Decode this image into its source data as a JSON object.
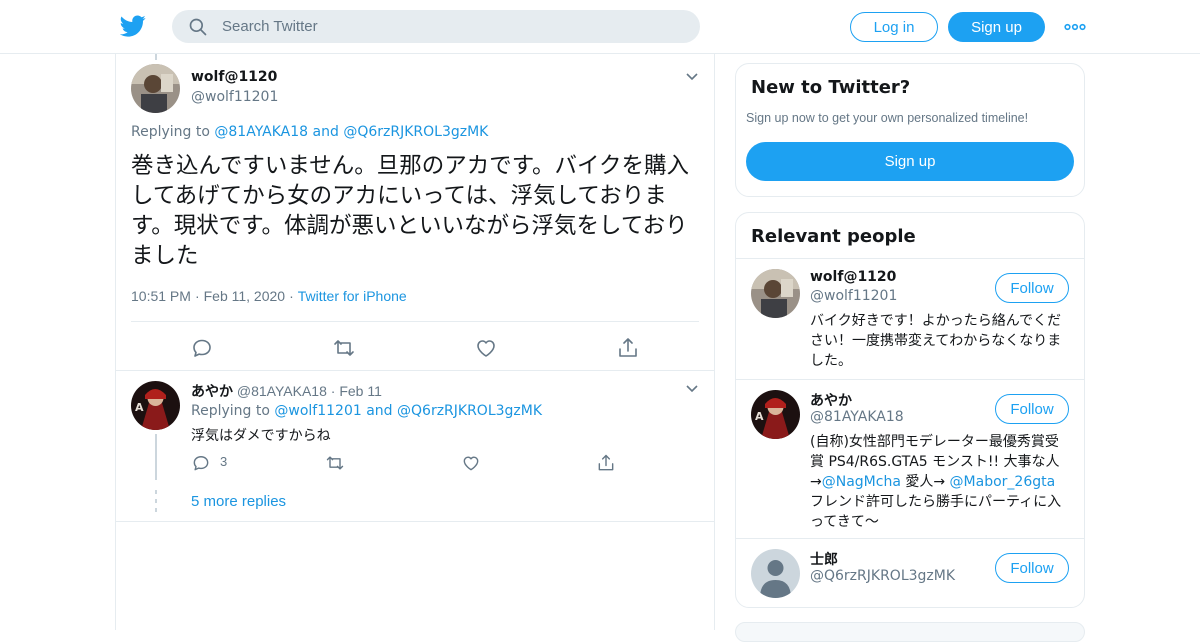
{
  "header": {
    "search_placeholder": "Search Twitter",
    "login_label": "Log in",
    "signup_label": "Sign up",
    "logo_icon": "twitter-bird-icon",
    "more_icon": "more-dots-icon",
    "brand_color": "#1da1f2"
  },
  "focused_tweet": {
    "name": "wolf@1120",
    "handle": "@wolf11201",
    "replying_prefix": "Replying to",
    "replying_to_1": "@81AYAKA18",
    "replying_and": "and",
    "replying_to_2": "@Q6rzRJKROL3gzMK",
    "text": "巻き込んですいません。旦那のアカです。バイクを購入してあげてから女のアカにいっては、浮気しております。現状です。体調が悪いといいながら浮気をしておりました",
    "time": "10:51 PM",
    "sep": "·",
    "date": "Feb 11, 2020",
    "source": "Twitter for iPhone",
    "actions": [
      "reply-icon",
      "retweet-icon",
      "like-icon",
      "share-icon"
    ]
  },
  "reply_tweet": {
    "name": "あやか",
    "handle": "@81AYAKA18",
    "sep": "·",
    "date": "Feb 11",
    "replying_prefix": "Replying to",
    "replying_to_1": "@wolf11201",
    "replying_and": "and",
    "replying_to_2": "@Q6rzRJKROL3gzMK",
    "text": "浮気はダメですからね",
    "reply_count": "3",
    "more_replies": "5 more replies"
  },
  "sidebar": {
    "new_to_twitter": {
      "title": "New to Twitter?",
      "subtitle": "Sign up now to get your own personalized timeline!",
      "button": "Sign up"
    },
    "relevant_people": {
      "title": "Relevant people",
      "follow_label": "Follow",
      "people": [
        {
          "name": "wolf@1120",
          "handle": "@wolf11201",
          "bio": "バイク好きです！よかったら絡んでください！一度携帯変えてわからなくなりました。"
        },
        {
          "name": "あやか",
          "handle": "@81AYAKA18",
          "bio_part1": "(自称)女性部門モデレーター最優秀賞受賞 PS4/R6S.GTA5 モンスト!! 大事な人→",
          "bio_mention1": "@NagMcha",
          "bio_part2": " 愛人→ ",
          "bio_mention2": "@Mabor_26gta",
          "bio_part3": " フレンド許可したら勝手にパーティに入ってきて〜"
        },
        {
          "name": "士郎",
          "handle": "@Q6rzRJKROL3gzMK"
        }
      ]
    }
  }
}
